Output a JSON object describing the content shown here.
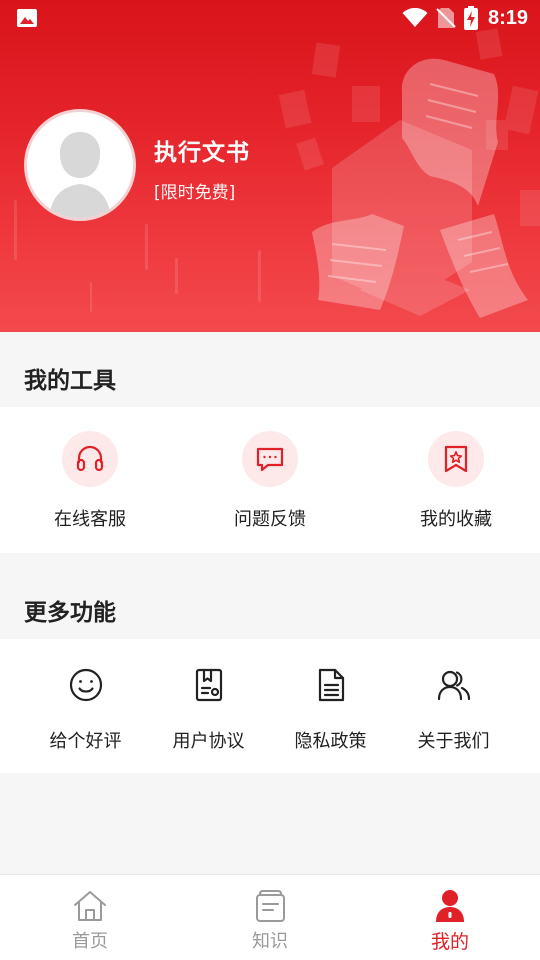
{
  "status_bar": {
    "time": "8:19"
  },
  "profile": {
    "name": "执行文书",
    "tag": "[限时免费]"
  },
  "tools": {
    "title": "我的工具",
    "items": [
      {
        "label": "在线客服",
        "icon": "headset-icon"
      },
      {
        "label": "问题反馈",
        "icon": "chat-bubble-icon"
      },
      {
        "label": "我的收藏",
        "icon": "bookmark-star-icon"
      }
    ]
  },
  "more": {
    "title": "更多功能",
    "items": [
      {
        "label": "给个好评",
        "icon": "smiley-icon"
      },
      {
        "label": "用户协议",
        "icon": "agreement-icon"
      },
      {
        "label": "隐私政策",
        "icon": "document-icon"
      },
      {
        "label": "关于我们",
        "icon": "users-icon"
      }
    ]
  },
  "bottom_nav": {
    "items": [
      {
        "label": "首页",
        "icon": "home-icon",
        "active": false
      },
      {
        "label": "知识",
        "icon": "notebook-icon",
        "active": false
      },
      {
        "label": "我的",
        "icon": "person-icon",
        "active": true
      }
    ]
  },
  "colors": {
    "accent": "#e02128",
    "icon_bg": "#fde9ea",
    "header_top": "#d9141b",
    "header_bottom": "#f24a4e"
  }
}
